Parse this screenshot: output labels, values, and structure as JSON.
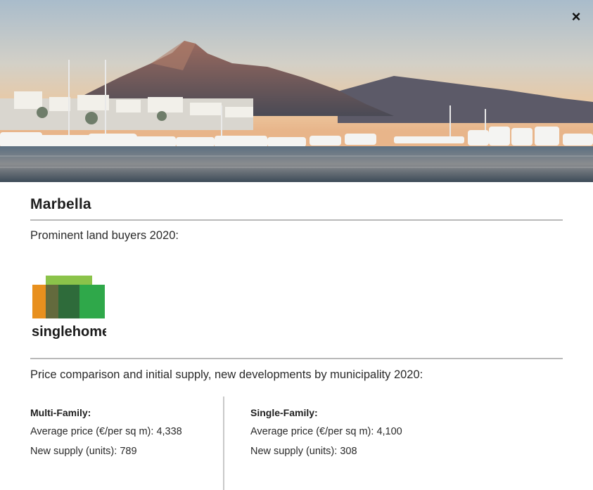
{
  "modal": {
    "close_label": "×",
    "city": "Marbella",
    "buyers_heading": "Prominent land buyers 2020:",
    "buyer_logo_text": "singlehome",
    "comparison_heading": "Price comparison and initial supply, new developments by municipality 2020:",
    "multi_family": {
      "title": "Multi-Family:",
      "price_label": "Average price (€/per sq m):",
      "price_value": "4,338",
      "supply_label": "New supply (units):",
      "supply_value": "789"
    },
    "single_family": {
      "title": "Single-Family:",
      "price_label": "Average price (€/per sq m):",
      "price_value": "4,100",
      "supply_label": "New supply (units):",
      "supply_value": "308"
    }
  }
}
